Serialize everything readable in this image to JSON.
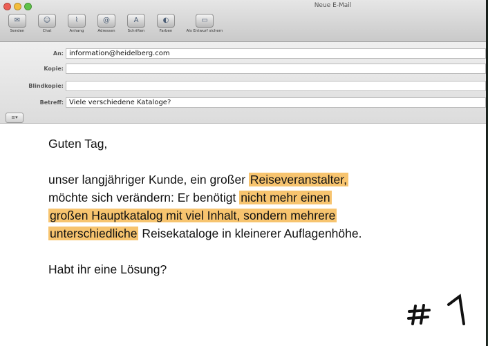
{
  "window": {
    "title": "Neue E-Mail"
  },
  "toolbar": {
    "buttons": [
      {
        "label": "Senden",
        "icon": "send-icon"
      },
      {
        "label": "Chat",
        "icon": "chat-icon"
      },
      {
        "label": "Anhang",
        "icon": "paperclip-icon"
      },
      {
        "label": "Adressen",
        "icon": "address-book-icon"
      },
      {
        "label": "Schriften",
        "icon": "fonts-icon"
      },
      {
        "label": "Farben",
        "icon": "colors-icon"
      },
      {
        "label": "Als Entwurf sichern",
        "icon": "draft-icon"
      }
    ]
  },
  "headers": {
    "to": {
      "label": "An:",
      "value": "information@heidelberg.com"
    },
    "cc": {
      "label": "Kopie:",
      "value": ""
    },
    "bcc": {
      "label": "Blindkopie:",
      "value": ""
    },
    "subject": {
      "label": "Betreff:",
      "value": "Viele verschiedene Kataloge?"
    }
  },
  "account_menu": {
    "icon": "account-icon"
  },
  "message": {
    "greeting": "Guten Tag,",
    "p1": {
      "a": "unser langjähriger Kunde, ein großer ",
      "b": "Reiseveranstalter,",
      "c": "möchte sich verändern: Er benötigt ",
      "d": "nicht mehr einen",
      "e": "großen Hauptkatalog mit viel Inhalt, sondern mehrere",
      "f": "unterschiedliche",
      "g": " Reisekataloge in kleinerer Auflagenhöhe."
    },
    "question": "Habt ihr eine Lösung?"
  },
  "stamp": {
    "text": "#1"
  },
  "colors": {
    "highlight": "#f7c46f",
    "traffic_close": "#ec5f56",
    "traffic_min": "#f3bd3c",
    "traffic_max": "#5fc24a"
  }
}
